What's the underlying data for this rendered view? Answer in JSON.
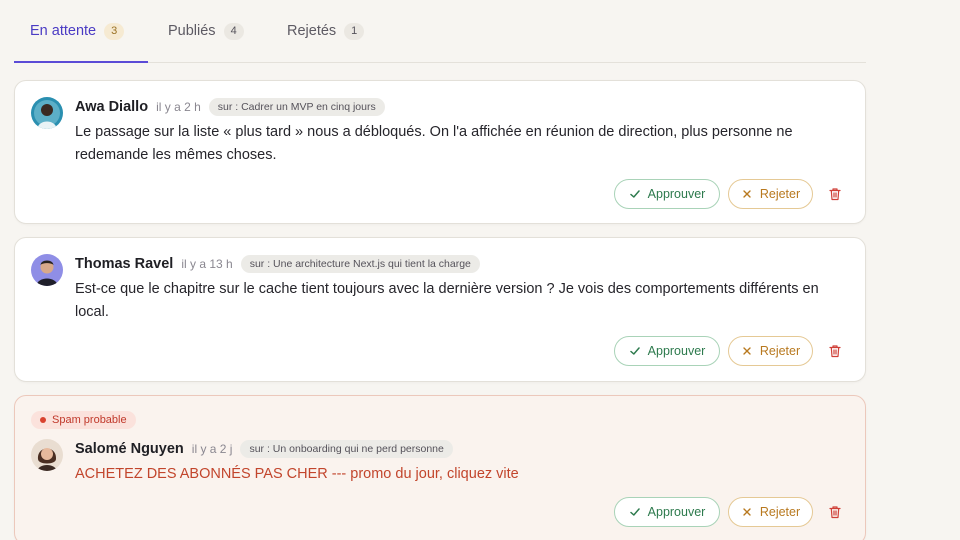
{
  "tabs": [
    {
      "label": "En attente",
      "count": "3"
    },
    {
      "label": "Publiés",
      "count": "4"
    },
    {
      "label": "Rejetés",
      "count": "1"
    }
  ],
  "comments": [
    {
      "author": "Awa Diallo",
      "time": "il y a 2 h",
      "post": "sur : Cadrer un MVP en cinq jours",
      "text": "Le passage sur la liste « plus tard » nous a débloqués. On l'a affichée en réunion de direction, plus personne ne redemande les mêmes choses.",
      "spam": false
    },
    {
      "author": "Thomas Ravel",
      "time": "il y a 13 h",
      "post": "sur : Une architecture Next.js qui tient la charge",
      "text": "Est-ce que le chapitre sur le cache tient toujours avec la dernière version ? Je vois des comportements différents en local.",
      "spam": false
    },
    {
      "author": "Salomé Nguyen",
      "time": "il y a 2 j",
      "post": "sur : Un onboarding qui ne perd personne",
      "text": "ACHETEZ DES ABONNÉS PAS CHER --- promo du jour, cliquez vite",
      "spam": true,
      "spam_label": "Spam probable"
    }
  ],
  "actions": {
    "approve_label": "Approuver",
    "reject_label": "Rejeter",
    "approve_icon": "check-icon",
    "reject_icon": "x-icon",
    "delete_icon": "trash-icon"
  },
  "colors": {
    "accent": "#5b4bd6",
    "approve": "#2d7a4d",
    "reject": "#b8791f",
    "danger": "#cf3f37"
  }
}
